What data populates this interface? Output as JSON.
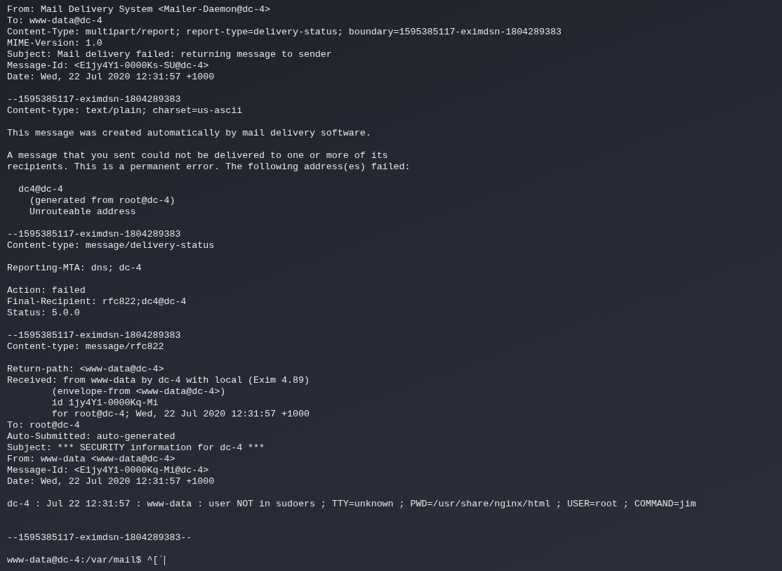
{
  "terminal": {
    "lines": [
      {
        "kind": "text",
        "text": "From: Mail Delivery System <Mailer-Daemon@dc-4>"
      },
      {
        "kind": "text",
        "text": "To: www-data@dc-4"
      },
      {
        "kind": "text",
        "text": "Content-Type: multipart/report; report-type=delivery-status; boundary=1595385117-eximdsn-1804289383"
      },
      {
        "kind": "text",
        "text": "MIME-Version: 1.0"
      },
      {
        "kind": "text",
        "text": "Subject: Mail delivery failed: returning message to sender"
      },
      {
        "kind": "text",
        "text": "Message-Id: <E1jy4Y1-0000Ks-SU@dc-4>"
      },
      {
        "kind": "text",
        "text": "Date: Wed, 22 Jul 2020 12:31:57 +1000"
      },
      {
        "kind": "blank"
      },
      {
        "kind": "text",
        "text": "--1595385117-eximdsn-1804289383"
      },
      {
        "kind": "text",
        "text": "Content-type: text/plain; charset=us-ascii"
      },
      {
        "kind": "blank"
      },
      {
        "kind": "text",
        "text": "This message was created automatically by mail delivery software."
      },
      {
        "kind": "blank"
      },
      {
        "kind": "text",
        "text": "A message that you sent could not be delivered to one or more of its"
      },
      {
        "kind": "text",
        "text": "recipients. This is a permanent error. The following address(es) failed:"
      },
      {
        "kind": "blank"
      },
      {
        "kind": "text",
        "text": "  dc4@dc-4"
      },
      {
        "kind": "text",
        "text": "    (generated from root@dc-4)"
      },
      {
        "kind": "text",
        "text": "    Unrouteable address"
      },
      {
        "kind": "blank"
      },
      {
        "kind": "text",
        "text": "--1595385117-eximdsn-1804289383"
      },
      {
        "kind": "text",
        "text": "Content-type: message/delivery-status"
      },
      {
        "kind": "blank"
      },
      {
        "kind": "text",
        "text": "Reporting-MTA: dns; dc-4"
      },
      {
        "kind": "blank"
      },
      {
        "kind": "text",
        "text": "Action: failed"
      },
      {
        "kind": "text",
        "text": "Final-Recipient: rfc822;dc4@dc-4"
      },
      {
        "kind": "text",
        "text": "Status: 5.0.0"
      },
      {
        "kind": "blank"
      },
      {
        "kind": "text",
        "text": "--1595385117-eximdsn-1804289383"
      },
      {
        "kind": "text",
        "text": "Content-type: message/rfc822"
      },
      {
        "kind": "blank"
      },
      {
        "kind": "text",
        "text": "Return-path: <www-data@dc-4>"
      },
      {
        "kind": "text",
        "text": "Received: from www-data by dc-4 with local (Exim 4.89)"
      },
      {
        "kind": "text",
        "text": "        (envelope-from <www-data@dc-4>)"
      },
      {
        "kind": "text",
        "text": "        id 1jy4Y1-0000Kq-Mi"
      },
      {
        "kind": "text",
        "text": "        for root@dc-4; Wed, 22 Jul 2020 12:31:57 +1000"
      },
      {
        "kind": "text",
        "text": "To: root@dc-4"
      },
      {
        "kind": "text",
        "text": "Auto-Submitted: auto-generated"
      },
      {
        "kind": "text",
        "text": "Subject: *** SECURITY information for dc-4 ***"
      },
      {
        "kind": "text",
        "text": "From: www-data <www-data@dc-4>"
      },
      {
        "kind": "text",
        "text": "Message-Id: <E1jy4Y1-0000Kq-Mi@dc-4>"
      },
      {
        "kind": "text",
        "text": "Date: Wed, 22 Jul 2020 12:31:57 +1000"
      },
      {
        "kind": "blank"
      },
      {
        "kind": "text",
        "text": "dc-4 : Jul 22 12:31:57 : www-data : user NOT in sudoers ; TTY=unknown ; PWD=/usr/share/nginx/html ; USER=root ; COMMAND=jim"
      },
      {
        "kind": "blank"
      },
      {
        "kind": "blank"
      },
      {
        "kind": "text",
        "text": "--1595385117-eximdsn-1804289383--"
      },
      {
        "kind": "blank"
      },
      {
        "kind": "prompt",
        "text": "www-data@dc-4:/var/mail$ ^[`",
        "cursor": true
      }
    ]
  }
}
